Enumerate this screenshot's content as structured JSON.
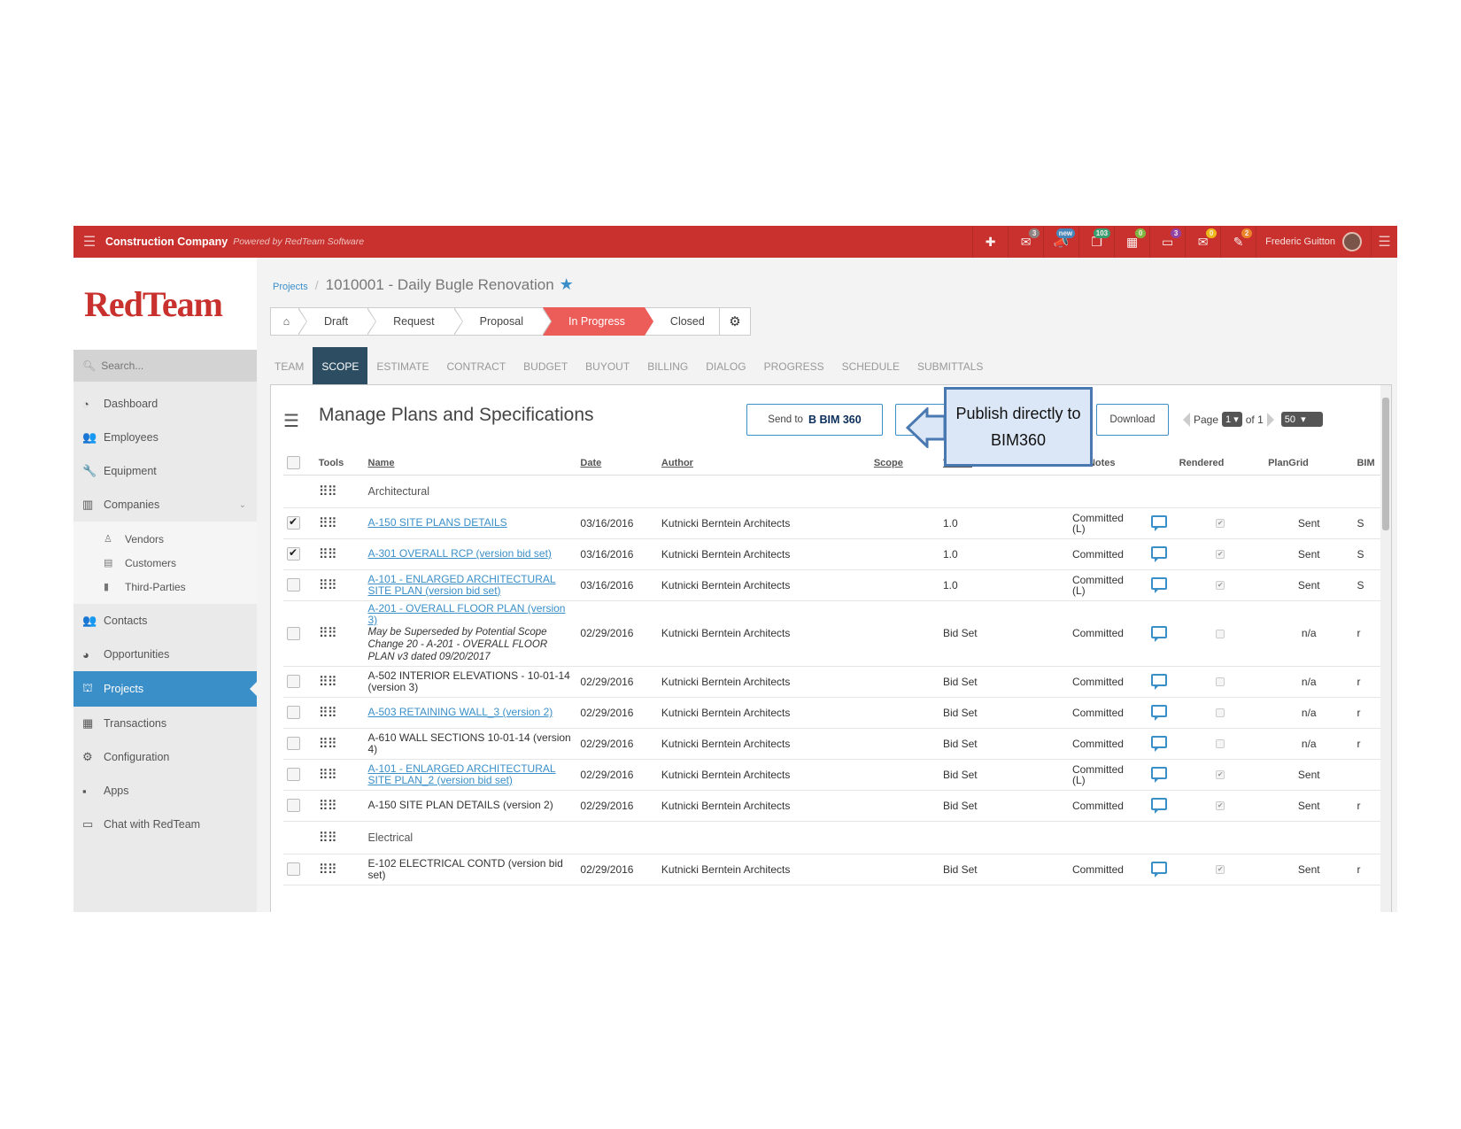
{
  "topbar": {
    "company": "Construction Company",
    "powered_by": "Powered by RedTeam Software",
    "user_name": "Frederic Guitton",
    "icons": [
      {
        "name": "add-icon",
        "glyph": "✚",
        "badge": "",
        "badge_color": ""
      },
      {
        "name": "mail-icon",
        "glyph": "✉",
        "badge": "3",
        "badge_color": "#8a8a8a"
      },
      {
        "name": "megaphone-icon",
        "glyph": "📣",
        "badge": "new",
        "badge_color": "#3a8fc8"
      },
      {
        "name": "documents-icon",
        "glyph": "❐",
        "badge": "103",
        "badge_color": "#2aa876"
      },
      {
        "name": "calendar-icon",
        "glyph": "▦",
        "badge": "0",
        "badge_color": "#7ac143"
      },
      {
        "name": "monitor-icon",
        "glyph": "▭",
        "badge": "3",
        "badge_color": "#8e44ad"
      },
      {
        "name": "inbox-icon",
        "glyph": "✉",
        "badge": "0",
        "badge_color": "#f0c419"
      },
      {
        "name": "chat-icon",
        "glyph": "✎",
        "badge": "2",
        "badge_color": "#f08c29"
      }
    ]
  },
  "sidebar": {
    "logo": "RedTeam",
    "search_placeholder": "Search...",
    "items": [
      {
        "label": "Dashboard",
        "icon": "dashboard-icon",
        "glyph": "◔"
      },
      {
        "label": "Employees",
        "icon": "employees-icon",
        "glyph": "👥"
      },
      {
        "label": "Equipment",
        "icon": "wrench-icon",
        "glyph": "🔧"
      },
      {
        "label": "Companies",
        "icon": "building-icon",
        "glyph": "▥"
      }
    ],
    "sub_items": [
      {
        "label": "Vendors",
        "icon": "vendor-icon",
        "glyph": "♙"
      },
      {
        "label": "Customers",
        "icon": "customer-icon",
        "glyph": "▤"
      },
      {
        "label": "Third-Parties",
        "icon": "third-party-icon",
        "glyph": "▮"
      }
    ],
    "items2": [
      {
        "label": "Contacts",
        "icon": "contacts-icon",
        "glyph": "👥"
      },
      {
        "label": "Opportunities",
        "icon": "opportunities-icon",
        "glyph": "◕"
      },
      {
        "label": "Projects",
        "icon": "projects-icon",
        "glyph": "⛫"
      },
      {
        "label": "Transactions",
        "icon": "calculator-icon",
        "glyph": "▦"
      },
      {
        "label": "Configuration",
        "icon": "gear-icon",
        "glyph": "⚙"
      },
      {
        "label": "Apps",
        "icon": "apps-icon",
        "glyph": "▪"
      },
      {
        "label": "Chat with RedTeam",
        "icon": "chat-bubble-icon",
        "glyph": "▭"
      }
    ]
  },
  "breadcrumb": {
    "root": "Projects",
    "title": "1010001 - Daily Bugle Renovation"
  },
  "stages": [
    "Draft",
    "Request",
    "Proposal",
    "In Progress",
    "Closed"
  ],
  "tabs": [
    "TEAM",
    "SCOPE",
    "ESTIMATE",
    "CONTRACT",
    "BUDGET",
    "BUYOUT",
    "BILLING",
    "DIALOG",
    "PROGRESS",
    "SCHEDULE",
    "SUBMITTALS"
  ],
  "panel": {
    "title": "Manage Plans and Specifications",
    "send_to": "Send to",
    "bim_label": "BIM 360",
    "download": "Download",
    "page_label": "Page",
    "page_value": "1",
    "of_label": "of 1",
    "per_page": "50"
  },
  "columns": [
    "Tools",
    "Name",
    "Date",
    "Author",
    "Scope",
    "Versio",
    "Notes",
    "Rendered",
    "PlanGrid",
    "BIM"
  ],
  "groups": [
    {
      "name": "Architectural",
      "rows": [
        {
          "checked": true,
          "name": "A-150 SITE PLANS DETAILS",
          "link": true,
          "note": "",
          "date": "03/16/2016",
          "author": "Kutnicki Berntein Architects",
          "version": "1.0",
          "status": "Committed (L)",
          "rendered": true,
          "plangrid": "Sent",
          "bim": "S"
        },
        {
          "checked": true,
          "name": "A-301 OVERALL RCP (version bid set)",
          "link": true,
          "note": "",
          "date": "03/16/2016",
          "author": "Kutnicki Berntein Architects",
          "version": "1.0",
          "status": "Committed",
          "rendered": true,
          "plangrid": "Sent",
          "bim": "S"
        },
        {
          "checked": false,
          "name": "A-101 - ENLARGED ARCHITECTURAL SITE PLAN (version bid set)",
          "link": true,
          "note": "",
          "date": "03/16/2016",
          "author": "Kutnicki Berntein Architects",
          "version": "1.0",
          "status": "Committed (L)",
          "rendered": true,
          "plangrid": "Sent",
          "bim": "S"
        },
        {
          "checked": false,
          "name": "A-201 - OVERALL FLOOR PLAN (version 3)",
          "link": true,
          "note": "May be Superseded by Potential Scope Change 20 - A-201 - OVERALL FLOOR PLAN v3 dated 09/20/2017",
          "date": "02/29/2016",
          "author": "Kutnicki Berntein Architects",
          "version": "Bid Set",
          "status": "Committed",
          "rendered": false,
          "plangrid": "n/a",
          "bim": "r"
        },
        {
          "checked": false,
          "name": "A-502 INTERIOR ELEVATIONS - 10-01-14 (version 3)",
          "link": false,
          "note": "",
          "date": "02/29/2016",
          "author": "Kutnicki Berntein Architects",
          "version": "Bid Set",
          "status": "Committed",
          "rendered": false,
          "plangrid": "n/a",
          "bim": "r"
        },
        {
          "checked": false,
          "name": "A-503 RETAINING WALL_3 (version 2)",
          "link": true,
          "note": "",
          "date": "02/29/2016",
          "author": "Kutnicki Berntein Architects",
          "version": "Bid Set",
          "status": "Committed",
          "rendered": false,
          "plangrid": "n/a",
          "bim": "r"
        },
        {
          "checked": false,
          "name": "A-610 WALL SECTIONS 10-01-14 (version 4)",
          "link": false,
          "note": "",
          "date": "02/29/2016",
          "author": "Kutnicki Berntein Architects",
          "version": "Bid Set",
          "status": "Committed",
          "rendered": false,
          "plangrid": "n/a",
          "bim": "r"
        },
        {
          "checked": false,
          "name": "A-101 - ENLARGED ARCHITECTURAL SITE PLAN_2 (version bid set)",
          "link": true,
          "note": "",
          "date": "02/29/2016",
          "author": "Kutnicki Berntein Architects",
          "version": "Bid Set",
          "status": "Committed (L)",
          "rendered": true,
          "plangrid": "Sent",
          "bim": ""
        },
        {
          "checked": false,
          "name": "A-150 SITE PLAN DETAILS (version 2)",
          "link": false,
          "note": "",
          "date": "02/29/2016",
          "author": "Kutnicki Berntein Architects",
          "version": "Bid Set",
          "status": "Committed",
          "rendered": true,
          "plangrid": "Sent",
          "bim": "r"
        }
      ]
    },
    {
      "name": "Electrical",
      "rows": [
        {
          "checked": false,
          "name": "E-102 ELECTRICAL CONTD (version bid set)",
          "link": false,
          "note": "",
          "date": "02/29/2016",
          "author": "Kutnicki Berntein Architects",
          "version": "Bid Set",
          "status": "Committed",
          "rendered": true,
          "plangrid": "Sent",
          "bim": "r"
        }
      ]
    }
  ],
  "callout": {
    "text": "Publish directly to BIM360"
  }
}
